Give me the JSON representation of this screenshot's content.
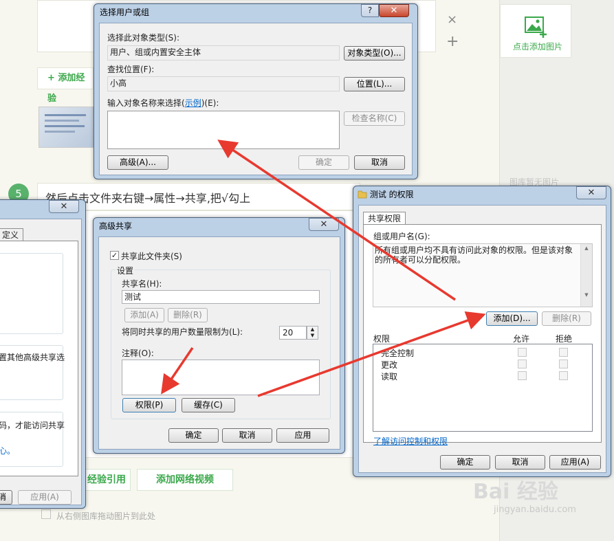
{
  "background": {
    "step_number": "5",
    "step_text": "然后点击文件夹右键→属性→共享,把√勾上",
    "add_experience_label": "+ 添加经验",
    "right_add_image_label": "点击添加图片",
    "right_empty_label": "图库暂无图片",
    "add_video_label": "添加网络视频",
    "add_reference_label": "经验引用",
    "drag_hint": "从右侧图库拖动图片到此处",
    "close_mark": "×",
    "plus_mark": "+",
    "watermark_brand": "Bai 经验",
    "watermark_url": "jingyan.baidu.com"
  },
  "left_partial": {
    "tab_label": "定义",
    "text1": "置其他高级共享选",
    "text2": "码，才能访问共享",
    "text3": "心。",
    "cancel_label": "消",
    "apply_label": "应用(A)"
  },
  "select_users": {
    "title": "选择用户或组",
    "help_label": "?",
    "close_label": "✕",
    "object_type_label": "选择此对象类型(S):",
    "object_type_value": "用户、组或内置安全主体",
    "object_type_button": "对象类型(O)...",
    "location_label": "查找位置(F):",
    "location_value": "小高",
    "location_button": "位置(L)...",
    "enter_names_prefix": "输入对象名称来选择(",
    "enter_names_link": "示例",
    "enter_names_suffix": ")(E):",
    "names_value": "",
    "check_names_button": "检查名称(C)",
    "advanced_button": "高级(A)...",
    "ok_button": "确定",
    "cancel_button": "取消"
  },
  "advanced_sharing": {
    "title": "高级共享",
    "close_label": "✕",
    "share_checkbox_label": "共享此文件夹(S)",
    "share_checked": true,
    "settings_label": "设置",
    "share_name_label": "共享名(H):",
    "share_name_value": "测试",
    "add_button": "添加(A)",
    "remove_button": "删除(R)",
    "limit_label": "将同时共享的用户数量限制为(L):",
    "limit_value": "20",
    "comment_label": "注释(O):",
    "comment_value": "",
    "permissions_button": "权限(P)",
    "caching_button": "缓存(C)",
    "ok_button": "确定",
    "cancel_button": "取消",
    "apply_button": "应用"
  },
  "permissions": {
    "title": "测试 的权限",
    "close_label": "✕",
    "tab_label": "共享权限",
    "group_label": "组或用户名(G):",
    "group_message": "所有组或用户均不具有访问此对象的权限。但是该对象的所有者可以分配权限。",
    "add_button": "添加(D)...",
    "remove_button": "删除(R)",
    "perm_header": "权限",
    "allow_header": "允许",
    "deny_header": "拒绝",
    "rows": [
      {
        "name": "完全控制",
        "allow": false,
        "deny": false
      },
      {
        "name": "更改",
        "allow": false,
        "deny": false
      },
      {
        "name": "读取",
        "allow": false,
        "deny": false
      }
    ],
    "learn_link": "了解访问控制和权限",
    "ok_button": "确定",
    "cancel_button": "取消",
    "apply_button": "应用(A)"
  },
  "colors": {
    "arrow": "#e8392f",
    "accent_green": "#3aa84a",
    "titlebar_blue": "#bcd0e6"
  }
}
